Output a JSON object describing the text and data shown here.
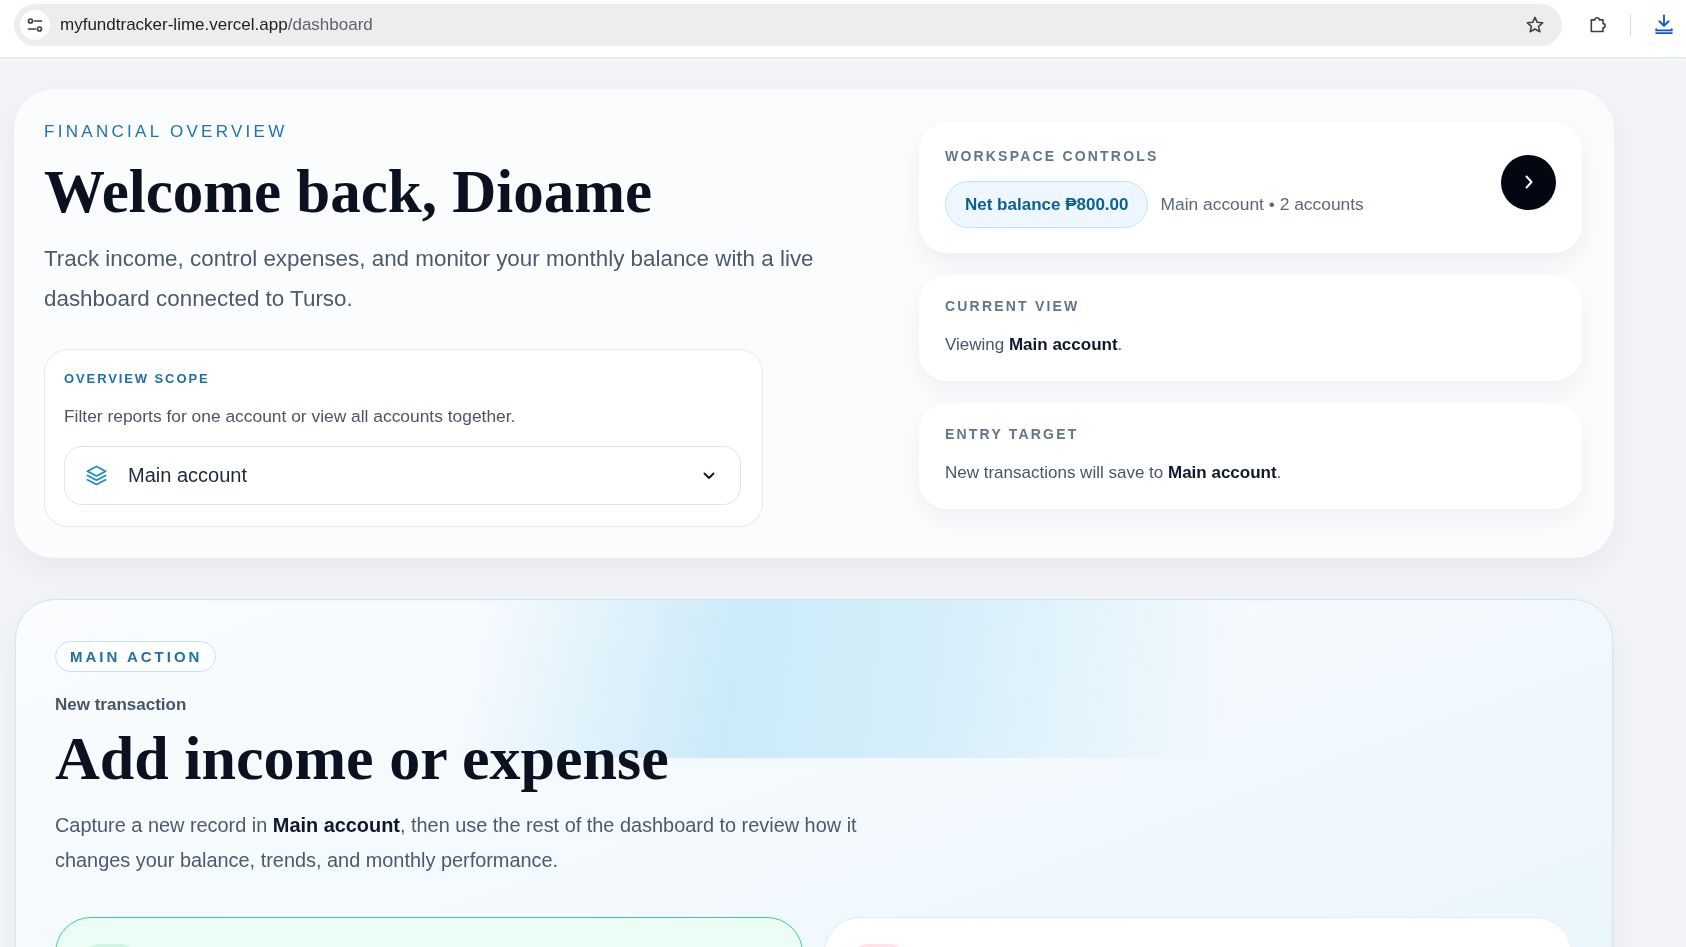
{
  "browser": {
    "url_host": "myfundtracker-lime.vercel.app",
    "url_path": "/dashboard"
  },
  "overview": {
    "eyebrow": "FINANCIAL OVERVIEW",
    "title": "Welcome back, Dioame",
    "description": "Track income, control expenses, and monitor your monthly balance with a live dashboard connected to Turso.",
    "scope": {
      "label": "OVERVIEW SCOPE",
      "hint": "Filter reports for one account or view all accounts together.",
      "account_select": {
        "value": "Main account"
      }
    }
  },
  "workspace_controls": {
    "label": "WORKSPACE CONTROLS",
    "balance": "Net balance ₱800.00",
    "summary": "Main account • 2 accounts"
  },
  "info_cards": [
    {
      "label": "CURRENT VIEW",
      "text": "Viewing **Main account**."
    },
    {
      "label": "ENTRY TARGET",
      "text": "New transactions will save to **Main account**."
    }
  ],
  "main_action": {
    "tag": "MAIN ACTION",
    "kicker": "New transaction",
    "title": "Add income or expense",
    "description": "Capture a new record in **Main account**, then use the rest of the dashboard to review how it changes your balance, trends, and monthly performance.",
    "entry_types": [
      {
        "selected": true,
        "color": "#d1f5e3"
      },
      {
        "selected": false,
        "color": "#fde2e7"
      }
    ]
  }
}
